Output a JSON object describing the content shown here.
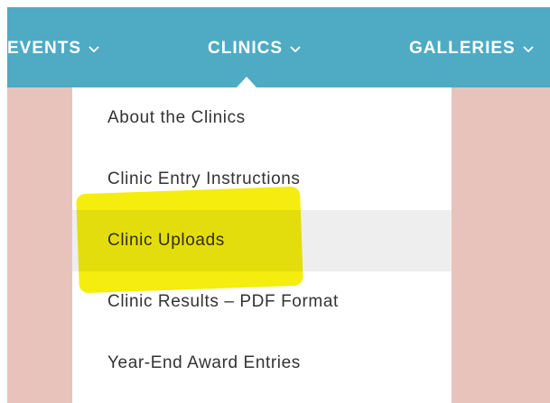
{
  "nav": {
    "items": [
      {
        "label": "EVENTS"
      },
      {
        "label": "CLINICS"
      },
      {
        "label": "GALLERIES"
      }
    ]
  },
  "dropdown": {
    "items": [
      {
        "label": "About the Clinics"
      },
      {
        "label": "Clinic Entry Instructions"
      },
      {
        "label": "Clinic Uploads"
      },
      {
        "label": "Clinic Results – PDF Format"
      },
      {
        "label": "Year-End Award Entries"
      }
    ],
    "hovered_label": "Clinic Uploads"
  },
  "colors": {
    "nav_bg": "#4fabc4",
    "page_bg": "#e8c3bb",
    "highlight": "#f4ec00"
  }
}
